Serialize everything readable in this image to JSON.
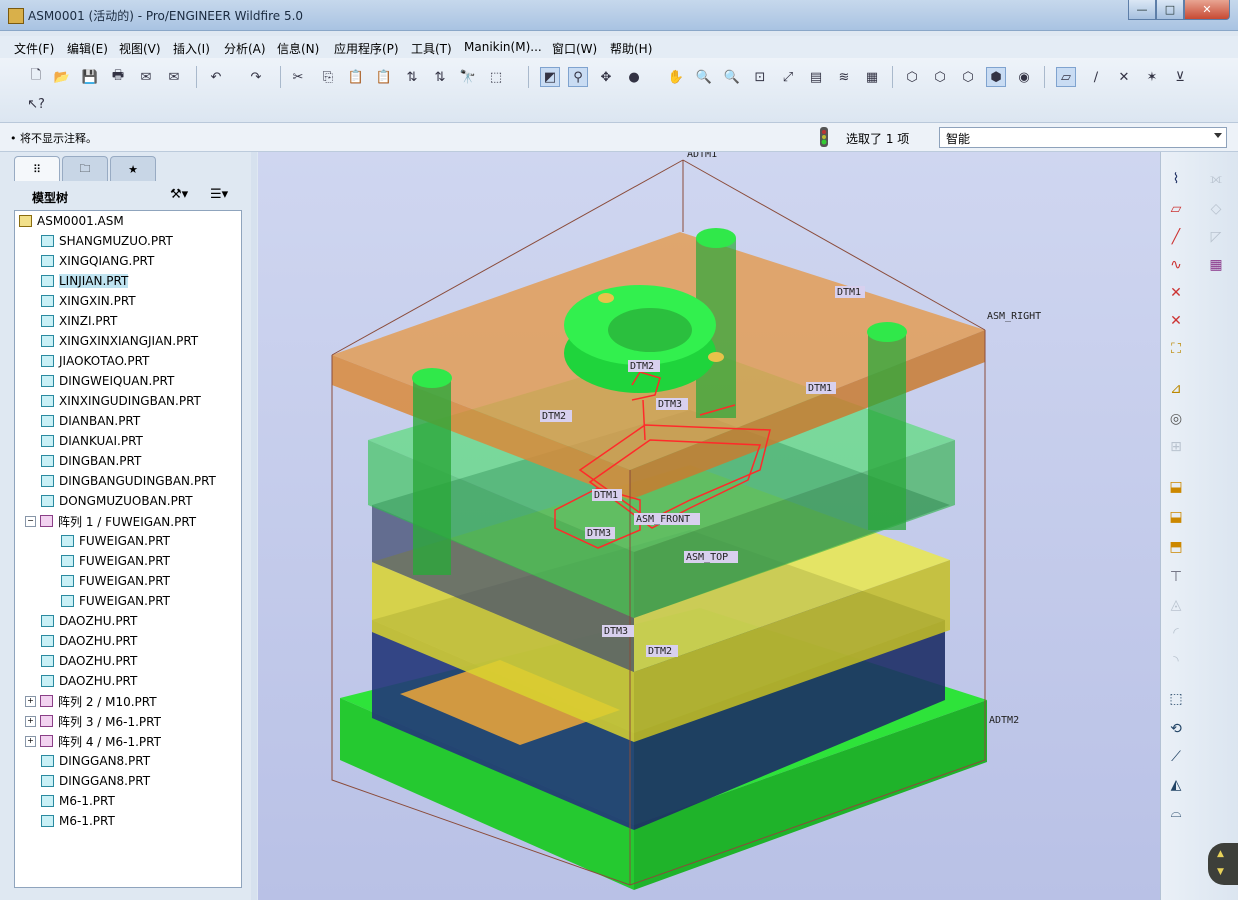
{
  "window": {
    "title": "ASM0001 (活动的) - Pro/ENGINEER Wildfire 5.0",
    "min": "—",
    "max": "□",
    "close": "✕"
  },
  "menu": [
    "文件(F)",
    "编辑(E)",
    "视图(V)",
    "插入(I)",
    "分析(A)",
    "信息(N)",
    "应用程序(P)",
    "工具(T)",
    "Manikin(M)...",
    "窗口(W)",
    "帮助(H)"
  ],
  "status": {
    "message": "• 将不显示注释。",
    "selection": "选取了 1 项",
    "filter": "智能"
  },
  "model_tree": {
    "title": "模型树",
    "items": [
      {
        "label": "ASM0001.ASM",
        "type": "asm",
        "indent": 0
      },
      {
        "label": "SHANGMUZUO.PRT",
        "type": "prt",
        "indent": 1
      },
      {
        "label": "XINGQIANG.PRT",
        "type": "prt",
        "indent": 1
      },
      {
        "label": "LINJIAN.PRT",
        "type": "prt",
        "indent": 1,
        "selected": true
      },
      {
        "label": "XINGXIN.PRT",
        "type": "prt",
        "indent": 1
      },
      {
        "label": "XINZI.PRT",
        "type": "prt",
        "indent": 1
      },
      {
        "label": "XINGXINXIANGJIAN.PRT",
        "type": "prt",
        "indent": 1
      },
      {
        "label": "JIAOKOTAO.PRT",
        "type": "prt",
        "indent": 1
      },
      {
        "label": "DINGWEIQUAN.PRT",
        "type": "prt",
        "indent": 1
      },
      {
        "label": "XINXINGUDINGBAN.PRT",
        "type": "prt",
        "indent": 1
      },
      {
        "label": "DIANBAN.PRT",
        "type": "prt",
        "indent": 1
      },
      {
        "label": "DIANKUAI.PRT",
        "type": "prt",
        "indent": 1
      },
      {
        "label": "DINGBAN.PRT",
        "type": "prt",
        "indent": 1
      },
      {
        "label": "DINGBANGUDINGBAN.PRT",
        "type": "prt",
        "indent": 1
      },
      {
        "label": "DONGMUZUOBAN.PRT",
        "type": "prt",
        "indent": 1
      },
      {
        "label": "阵列 1 / FUWEIGAN.PRT",
        "type": "pattern",
        "indent": 1,
        "expander": "−"
      },
      {
        "label": "FUWEIGAN.PRT",
        "type": "prt",
        "indent": 2
      },
      {
        "label": "FUWEIGAN.PRT",
        "type": "prt",
        "indent": 2
      },
      {
        "label": "FUWEIGAN.PRT",
        "type": "prt",
        "indent": 2
      },
      {
        "label": "FUWEIGAN.PRT",
        "type": "prt",
        "indent": 2
      },
      {
        "label": "DAOZHU.PRT",
        "type": "prt",
        "indent": 1
      },
      {
        "label": "DAOZHU.PRT",
        "type": "prt",
        "indent": 1
      },
      {
        "label": "DAOZHU.PRT",
        "type": "prt",
        "indent": 1
      },
      {
        "label": "DAOZHU.PRT",
        "type": "prt",
        "indent": 1
      },
      {
        "label": "阵列 2 / M10.PRT",
        "type": "pattern",
        "indent": 1,
        "expander": "+"
      },
      {
        "label": "阵列 3 / M6-1.PRT",
        "type": "pattern",
        "indent": 1,
        "expander": "+"
      },
      {
        "label": "阵列 4 / M6-1.PRT",
        "type": "pattern",
        "indent": 1,
        "expander": "+"
      },
      {
        "label": "DINGGAN8.PRT",
        "type": "prt",
        "indent": 1
      },
      {
        "label": "DINGGAN8.PRT",
        "type": "prt",
        "indent": 1
      },
      {
        "label": "M6-1.PRT",
        "type": "prt",
        "indent": 1
      },
      {
        "label": "M6-1.PRT",
        "type": "prt",
        "indent": 1
      }
    ]
  },
  "datum_labels": {
    "adtm1": "ADTM1",
    "dtm1_a": "DTM1",
    "asm_right": "ASM_RIGHT",
    "dtm2_a": "DTM2",
    "dtm1_b": "DTM1",
    "dtm3_a": "DTM3",
    "dtm2_b": "DTM2",
    "dtm1_c": "DTM1",
    "dtm3_b": "DTM3",
    "asm_front": "ASM_FRONT",
    "asm_top": "ASM_TOP",
    "dtm3_c": "DTM3",
    "dtm2_c": "DTM2",
    "adtm2": "ADTM2"
  },
  "navball": {
    "up": "▲",
    "down": "▼"
  },
  "colors": {
    "top_plate": "#e49a4c",
    "green_plate": "#27d13a",
    "yellow_plate": "#e6e23a",
    "blue_plate": "#2d3f7c",
    "wire": "#ff2a2a",
    "datum": "#8a4b3a"
  }
}
